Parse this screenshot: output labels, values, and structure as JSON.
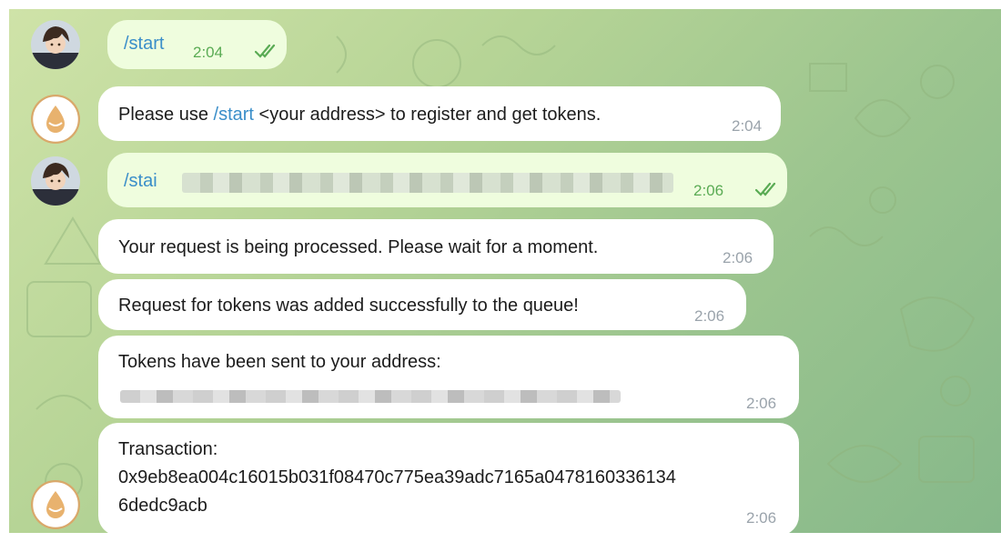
{
  "messages": [
    {
      "command": "/start",
      "time": "2:04"
    },
    {
      "prefix": "Please use ",
      "command": "/start",
      "suffix": " <your address> to register and get tokens.",
      "time": "2:04"
    },
    {
      "text": "/stai",
      "time": "2:06"
    },
    {
      "text": "Your request is being processed. Please wait for a moment.",
      "time": "2:06"
    },
    {
      "text": "Request for tokens was added successfully to the queue!",
      "time": "2:06"
    },
    {
      "text": "Tokens have been sent to your address:",
      "time": "2:06"
    },
    {
      "line1": "Transaction:",
      "line2": "0x9eb8ea004c16015b031f08470c775ea39adc7165a0478160336134",
      "line3": "6dedc9acb",
      "time": "2:06"
    }
  ],
  "colors": {
    "outgoing_bubble": "#effdde",
    "incoming_bubble": "#ffffff",
    "link": "#3a8ec9",
    "outgoing_time": "#5aab54",
    "incoming_time": "#9aa3ab"
  },
  "icons": {
    "user_avatar": "anime-character-avatar-icon",
    "bot_avatar": "water-drop-bot-avatar-icon",
    "read_status": "double-check-icon"
  }
}
